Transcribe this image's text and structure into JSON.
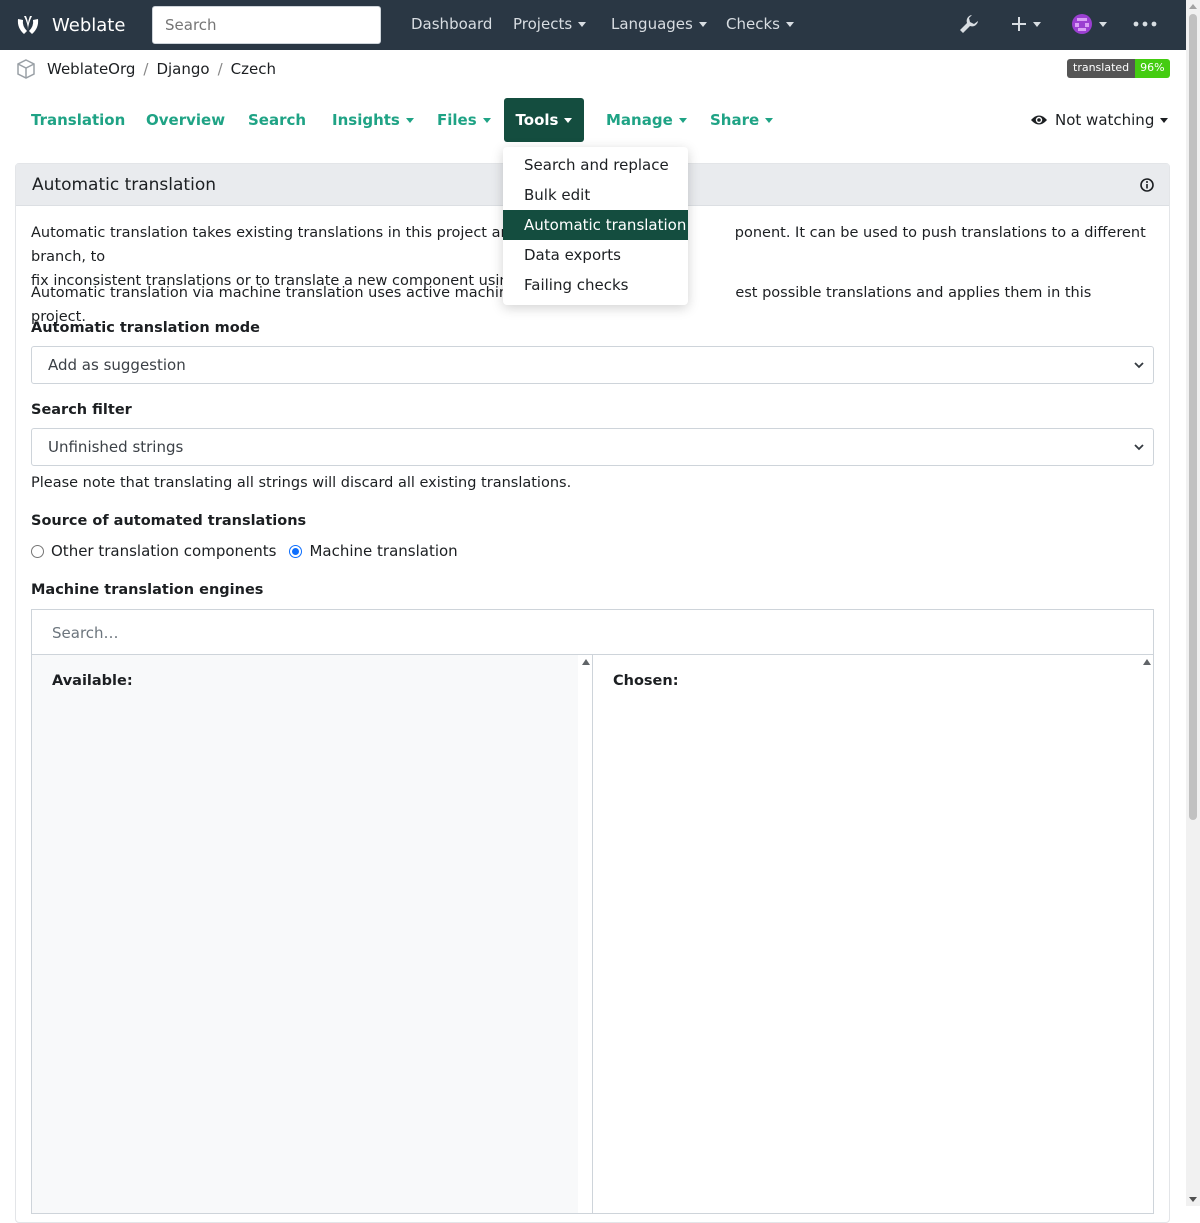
{
  "navbar": {
    "brand": "Weblate",
    "search_placeholder": "Search",
    "links": [
      {
        "label": "Dashboard"
      },
      {
        "label": "Projects"
      },
      {
        "label": "Languages"
      },
      {
        "label": "Checks"
      }
    ]
  },
  "breadcrumb": [
    "WeblateOrg",
    "Django",
    "Czech"
  ],
  "badge": {
    "label": "translated",
    "value": "96%"
  },
  "tabs": [
    "Translation",
    "Overview",
    "Search",
    "Insights",
    "Files",
    "Tools",
    "Manage",
    "Share"
  ],
  "watching": "Not watching",
  "tools_menu": [
    "Search and replace",
    "Bulk edit",
    "Automatic translation",
    "Data exports",
    "Failing checks"
  ],
  "panel": {
    "title": "Automatic translation",
    "para1_a": "Automatic translation takes existing translations in this project and app",
    "para1_b": "ponent. It can be used to push translations to a different branch, to",
    "para1_c": "fix inconsistent translations or to translate a new component using tran",
    "para2_a": "Automatic translation via machine translation uses active machine tran",
    "para2_b": "est possible translations and applies them in this project.",
    "mode_label": "Automatic translation mode",
    "mode_value": "Add as suggestion",
    "filter_label": "Search filter",
    "filter_value": "Unfinished strings",
    "filter_note": "Please note that translating all strings will discard all existing translations.",
    "source_label": "Source of automated translations",
    "source_option1": "Other translation components",
    "source_option2": "Machine translation",
    "engines_label": "Machine translation engines",
    "engines_search_placeholder": "Search…",
    "available_label": "Available:",
    "chosen_label": "Chosen:"
  }
}
